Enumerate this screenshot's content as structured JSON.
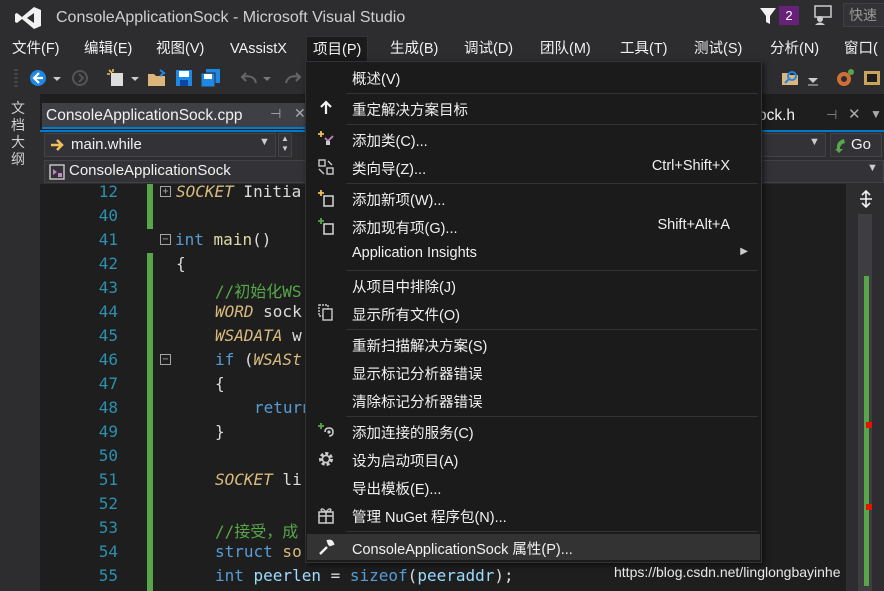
{
  "window": {
    "title": "ConsoleApplicationSock - Microsoft Visual Studio",
    "notification_count": "2",
    "quick_launch": "快速"
  },
  "menu": [
    {
      "name": "file",
      "label": "文件(F)"
    },
    {
      "name": "edit",
      "label": "编辑(E)"
    },
    {
      "name": "view",
      "label": "视图(V)"
    },
    {
      "name": "vassistx",
      "label": "VAssistX"
    },
    {
      "name": "project",
      "label": "项目(P)"
    },
    {
      "name": "build",
      "label": "生成(B)"
    },
    {
      "name": "debug",
      "label": "调试(D)"
    },
    {
      "name": "team",
      "label": "团队(M)"
    },
    {
      "name": "tools",
      "label": "工具(T)"
    },
    {
      "name": "test",
      "label": "测试(S)"
    },
    {
      "name": "analyze",
      "label": "分析(N)"
    },
    {
      "name": "window",
      "label": "窗口("
    }
  ],
  "left_tab": {
    "label": "文档大纲"
  },
  "document_tabs": {
    "active": {
      "label": "ConsoleApplicationSock.cpp"
    },
    "other": {
      "label": "ock.h"
    }
  },
  "navigation": {
    "function_combo": "main.while",
    "go_label": "Go",
    "scope_combo": "ConsoleApplicationSock"
  },
  "line_numbers": [
    "12",
    "40",
    "41",
    "42",
    "43",
    "44",
    "45",
    "46",
    "47",
    "48",
    "49",
    "50",
    "51",
    "52",
    "53",
    "54",
    "55"
  ],
  "code": {
    "l12_type": "SOCKET",
    "l12_rest": " Initia",
    "l41_kw": "int",
    "l41_fn": "main",
    "l41_paren": "()",
    "l42_brace": "{",
    "l43_comment": "//初始化WS",
    "l44_type": "WORD",
    "l44_rest": " sock",
    "l45_type": "WSADATA",
    "l45_rest": " w",
    "l46_kw": "if",
    "l46_paren": " (",
    "l46_type": "WSASt",
    "l47_brace": "{",
    "l48_kw": "return",
    "l49_brace": "}",
    "l51_type": "SOCKET",
    "l51_rest": " li",
    "l53_comment": "//接受，成",
    "l54_kw": "struct",
    "l54_type": " so",
    "l55_kw": "int",
    "l55_var": " peerlen",
    "l55_eq": " = ",
    "l55_fn": "sizeof",
    "l55_open": "(",
    "l55_arg": "peeraddr",
    "l55_close": ");"
  },
  "project_menu": [
    {
      "name": "overview",
      "label": "概述(V)",
      "shortcut": "",
      "icon": ""
    },
    {
      "name": "retarget",
      "label": "重定解决方案目标",
      "shortcut": "",
      "icon": "arrow-up-icon"
    },
    {
      "name": "add-class",
      "label": "添加类(C)...",
      "shortcut": "",
      "icon": "add-class-icon"
    },
    {
      "name": "class-wizard",
      "label": "类向导(Z)...",
      "shortcut": "Ctrl+Shift+X",
      "icon": "class-wizard-icon"
    },
    {
      "name": "add-new-item",
      "label": "添加新项(W)...",
      "shortcut": "",
      "icon": "add-new-item-icon"
    },
    {
      "name": "add-existing-item",
      "label": "添加现有项(G)...",
      "shortcut": "Shift+Alt+A",
      "icon": "add-existing-item-icon"
    },
    {
      "name": "application-insights",
      "label": "Application Insights",
      "shortcut": "",
      "icon": ""
    },
    {
      "name": "exclude-from-project",
      "label": "从项目中排除(J)",
      "shortcut": "",
      "icon": ""
    },
    {
      "name": "show-all-files",
      "label": "显示所有文件(O)",
      "shortcut": "",
      "icon": "show-all-files-icon"
    },
    {
      "name": "rescan-solution",
      "label": "重新扫描解决方案(S)",
      "shortcut": "",
      "icon": ""
    },
    {
      "name": "show-analyzer-errors",
      "label": "显示标记分析器错误",
      "shortcut": "",
      "icon": ""
    },
    {
      "name": "clear-analyzer-errors",
      "label": "清除标记分析器错误",
      "shortcut": "",
      "icon": ""
    },
    {
      "name": "add-connected-service",
      "label": "添加连接的服务(C)",
      "shortcut": "",
      "icon": "connected-service-icon"
    },
    {
      "name": "set-startup-project",
      "label": "设为启动项目(A)",
      "shortcut": "",
      "icon": "gear-icon"
    },
    {
      "name": "export-template",
      "label": "导出模板(E)...",
      "shortcut": "",
      "icon": ""
    },
    {
      "name": "manage-nuget",
      "label": "管理 NuGet 程序包(N)...",
      "shortcut": "",
      "icon": "nuget-package-icon"
    },
    {
      "name": "properties",
      "label": "ConsoleApplicationSock 属性(P)...",
      "shortcut": "",
      "icon": "wrench-icon"
    }
  ],
  "watermark": "https://blog.csdn.net/linglongbayinhe"
}
